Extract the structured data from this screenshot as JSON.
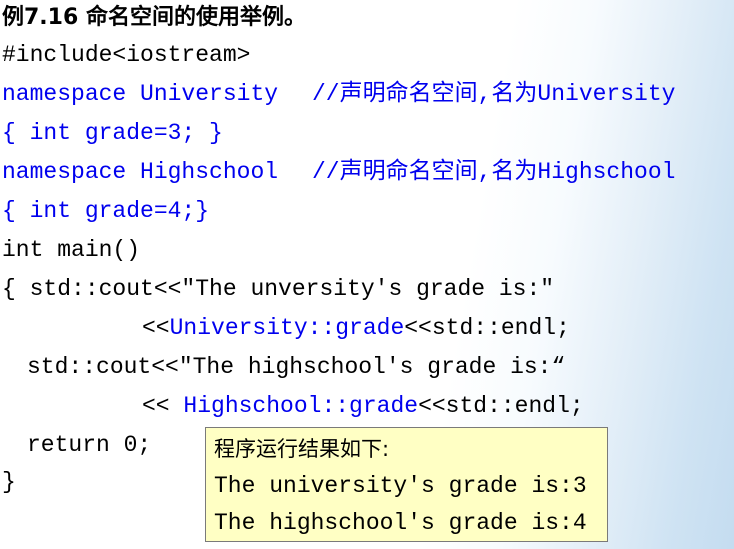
{
  "slide": {
    "title": "例7.16 命名空间的使用举例。",
    "code": {
      "include": "#include<iostream>",
      "ns1_decl": "namespace University",
      "ns1_comment": "//声明命名空间,名为University",
      "ns1_body": "{ int grade=3; }",
      "ns2_decl": "namespace Highschool",
      "ns2_comment": "//声明命名空间,名为Highschool",
      "ns2_body": "{ int grade=4;}",
      "main_sig": "int main()",
      "cout1": "{ std::cout<<\"The unversity's grade is:\"",
      "cout1_cont_pre": "<<",
      "cout1_cont_ref": "University::grade",
      "cout1_cont_post": "<<std::endl;",
      "cout2": "std::cout<<\"The highschool's grade is:“",
      "cout2_cont_pre": "<< ",
      "cout2_cont_ref": "Highschool::grade",
      "cout2_cont_post": "<<std::endl;",
      "return_stmt": "return 0;",
      "close_brace": "}"
    },
    "output": {
      "heading": "程序运行结果如下:",
      "line1": "The university's grade is:3",
      "line2": "The highschool's grade is:4"
    },
    "colors": {
      "keyword_blue": "#0000ee",
      "output_bg": "#ffffc4"
    }
  }
}
